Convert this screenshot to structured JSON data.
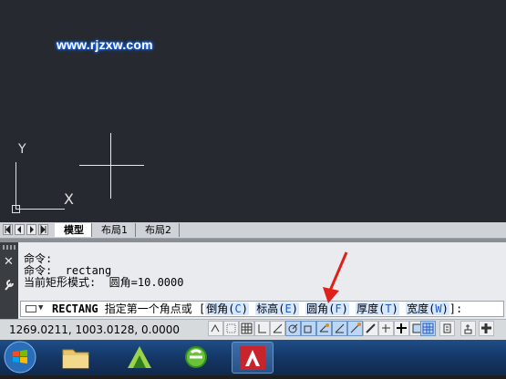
{
  "watermark": {
    "text": "www.rjzxw.com"
  },
  "ucs": {
    "y_label": "Y",
    "x_label": "X"
  },
  "layout_tabs": [
    {
      "label": "模型",
      "active": true
    },
    {
      "label": "布局1",
      "active": false
    },
    {
      "label": "布局2",
      "active": false
    }
  ],
  "command_history": [
    "命令:",
    "命令: _rectang",
    "当前矩形模式:  圆角=10.0000"
  ],
  "command_prompt": {
    "command": "RECTANG",
    "prompt": " 指定第一个角点或 [",
    "options": [
      {
        "label": "倒角",
        "key": "C"
      },
      {
        "label": "标高",
        "key": "E"
      },
      {
        "label": "圆角",
        "key": "F"
      },
      {
        "label": "厚度",
        "key": "T"
      },
      {
        "label": "宽度",
        "key": "W"
      }
    ],
    "suffix": "]:"
  },
  "status_bar": {
    "coordinates": "1269.0211, 1003.0128, 0.0000"
  },
  "taskbar": {
    "apps": [
      "start-orb",
      "file-explorer",
      "green-app",
      "internet-explorer",
      "autocad"
    ]
  },
  "colors": {
    "accent": "#2457c7",
    "arrow": "#e0201b",
    "drawing_bg": "#262a30"
  }
}
